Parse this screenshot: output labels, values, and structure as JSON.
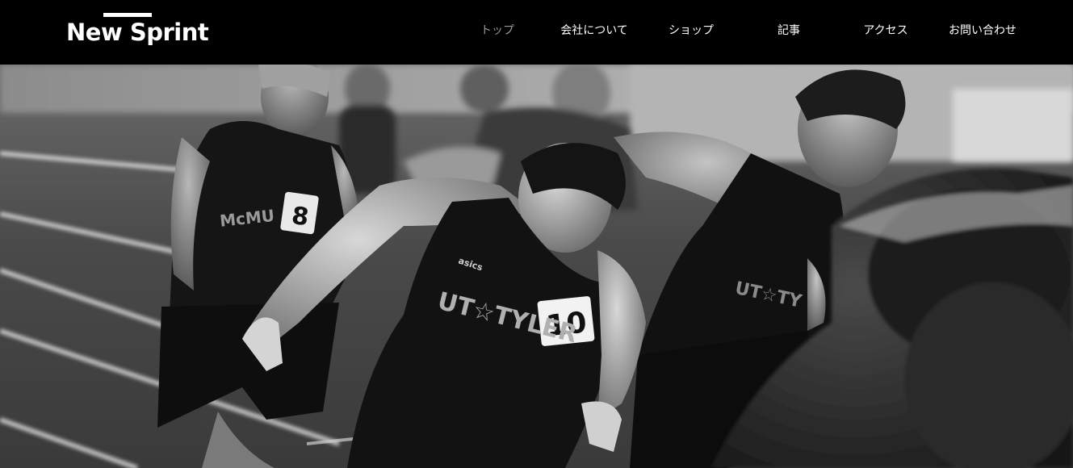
{
  "header": {
    "logo_text": "New Sprint"
  },
  "nav": {
    "items": [
      {
        "label": "トップ",
        "active": true
      },
      {
        "label": "会社について",
        "active": false
      },
      {
        "label": "ショップ",
        "active": false
      },
      {
        "label": "記事",
        "active": false
      },
      {
        "label": "アクセス",
        "active": false
      },
      {
        "label": "お問い合わせ",
        "active": false
      }
    ]
  },
  "hero": {
    "bib_left": "8",
    "bib_center": "10",
    "jersey_center": "UT☆TYLER",
    "jersey_right": "UT☆TY",
    "jersey_left": "McMU",
    "brand_mark": "asics"
  }
}
